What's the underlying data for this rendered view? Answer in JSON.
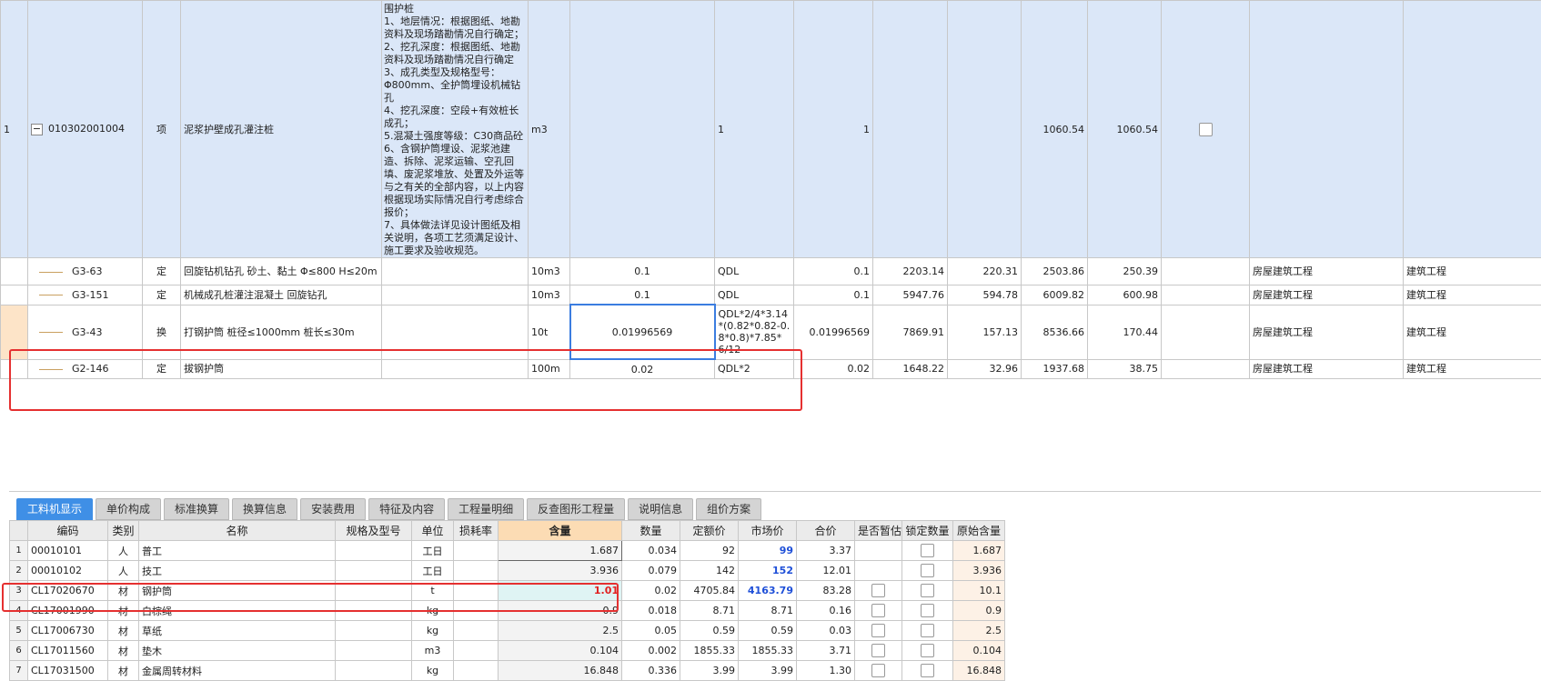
{
  "top_rows": [
    {
      "idx": "1",
      "code": "010302001004",
      "type": "项",
      "name": "泥浆护壁成孔灌注桩",
      "desc": "围护桩\n1、地层情况：根据图纸、地勘资料及现场踏勘情况自行确定；\n2、挖孔深度：根据图纸、地勘资料及现场踏勘情况自行确定\n3、成孔类型及规格型号：Φ800mm、全护筒埋设机械钻孔\n4、挖孔深度：空段+有效桩长成孔；\n5.混凝土强度等级：C30商品砼\n6、含钢护筒埋设、泥浆池建造、拆除、泥浆运输、空孔回填、废泥浆堆放、处置及外运等与之有关的全部内容，以上内容根据现场实际情况自行考虑综合报价；\n7、具体做法详见设计图纸及相关说明，各项工艺须满足设计、施工要求及验收规范。",
      "unit": "m3",
      "content": "",
      "expr": "1",
      "qty": "1",
      "price": "",
      "total": "",
      "price2": "1060.54",
      "total2": "1060.54",
      "col_a": "",
      "col_b": ""
    },
    {
      "idx": "",
      "code": "G3-63",
      "type": "定",
      "name": "回旋钻机钻孔 砂土、黏土 Φ≤800 H≤20m",
      "desc": "",
      "unit": "10m3",
      "content": "0.1",
      "expr": "QDL",
      "qty": "0.1",
      "price": "2203.14",
      "total": "220.31",
      "price2": "2503.86",
      "total2": "250.39",
      "col_a": "房屋建筑工程",
      "col_b": "建筑工程"
    },
    {
      "idx": "",
      "code": "G3-151",
      "type": "定",
      "name": "机械成孔桩灌注混凝土 回旋钻孔",
      "desc": "",
      "unit": "10m3",
      "content": "0.1",
      "expr": "QDL",
      "qty": "0.1",
      "price": "5947.76",
      "total": "594.78",
      "price2": "6009.82",
      "total2": "600.98",
      "col_a": "房屋建筑工程",
      "col_b": "建筑工程"
    },
    {
      "idx": "",
      "code": "G3-43",
      "type": "换",
      "name": "打钢护筒 桩径≤1000mm 桩长≤30m",
      "desc": "",
      "unit": "10t",
      "content": "0.01996569",
      "expr": "QDL*2/4*3.14*(0.82*0.82-0.8*0.8)*7.85*6/12",
      "qty": "0.01996569",
      "price": "7869.91",
      "total": "157.13",
      "price2": "8536.66",
      "total2": "170.44",
      "col_a": "房屋建筑工程",
      "col_b": "建筑工程"
    },
    {
      "idx": "",
      "code": "G2-146",
      "type": "定",
      "name": "拔钢护筒",
      "desc": "",
      "unit": "100m",
      "content": "0.02",
      "expr": "QDL*2",
      "qty": "0.02",
      "price": "1648.22",
      "total": "32.96",
      "price2": "1937.68",
      "total2": "38.75",
      "col_a": "房屋建筑工程",
      "col_b": "建筑工程"
    }
  ],
  "tabs": [
    "工料机显示",
    "单价构成",
    "标准换算",
    "换算信息",
    "安装费用",
    "特征及内容",
    "工程量明细",
    "反查图形工程量",
    "说明信息",
    "组价方案"
  ],
  "bottom_headers": [
    "",
    "编码",
    "类别",
    "名称",
    "规格及型号",
    "单位",
    "损耗率",
    "含量",
    "数量",
    "定额价",
    "市场价",
    "合价",
    "是否暂估",
    "锁定数量",
    "原始含量"
  ],
  "bottom_rows": [
    {
      "n": "1",
      "code": "00010101",
      "type": "人",
      "name": "普工",
      "spec": "",
      "unit": "工日",
      "loss": "",
      "qty": "1.687",
      "amount": "0.034",
      "base": "92",
      "market": "99",
      "total": "3.37",
      "orig": "1.687"
    },
    {
      "n": "2",
      "code": "00010102",
      "type": "人",
      "name": "技工",
      "spec": "",
      "unit": "工日",
      "loss": "",
      "qty": "3.936",
      "amount": "0.079",
      "base": "142",
      "market": "152",
      "total": "12.01",
      "orig": "3.936"
    },
    {
      "n": "3",
      "code": "CL17020670",
      "type": "材",
      "name": "钢护筒",
      "spec": "",
      "unit": "t",
      "loss": "",
      "qty": "1.01",
      "amount": "0.02",
      "base": "4705.84",
      "market": "4163.79",
      "total": "83.28",
      "orig": "10.1"
    },
    {
      "n": "4",
      "code": "CL17001990",
      "type": "材",
      "name": "白棕绳",
      "spec": "",
      "unit": "kg",
      "loss": "",
      "qty": "0.9",
      "amount": "0.018",
      "base": "8.71",
      "market": "8.71",
      "total": "0.16",
      "orig": "0.9"
    },
    {
      "n": "5",
      "code": "CL17006730",
      "type": "材",
      "name": "草纸",
      "spec": "",
      "unit": "kg",
      "loss": "",
      "qty": "2.5",
      "amount": "0.05",
      "base": "0.59",
      "market": "0.59",
      "total": "0.03",
      "orig": "2.5"
    },
    {
      "n": "6",
      "code": "CL17011560",
      "type": "材",
      "name": "垫木",
      "spec": "",
      "unit": "m3",
      "loss": "",
      "qty": "0.104",
      "amount": "0.002",
      "base": "1855.33",
      "market": "1855.33",
      "total": "3.71",
      "orig": "0.104"
    },
    {
      "n": "7",
      "code": "CL17031500",
      "type": "材",
      "name": "金属周转材料",
      "spec": "",
      "unit": "kg",
      "loss": "",
      "qty": "16.848",
      "amount": "0.336",
      "base": "3.99",
      "market": "3.99",
      "total": "1.30",
      "orig": "16.848"
    }
  ]
}
